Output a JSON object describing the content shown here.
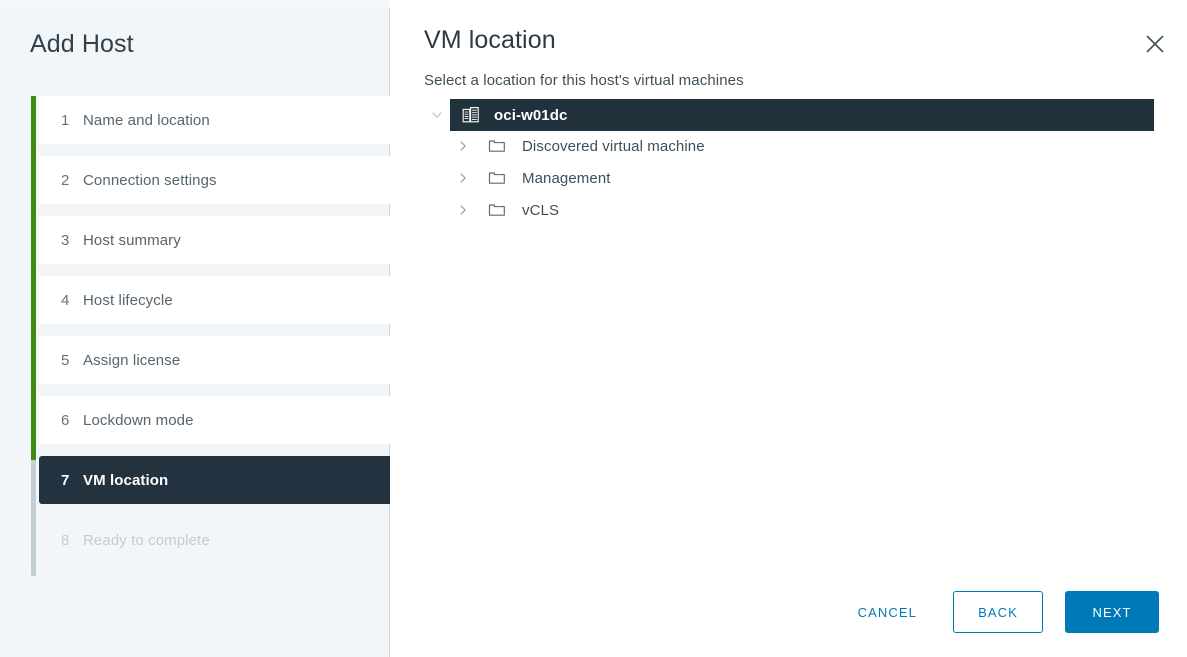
{
  "wizard": {
    "title": "Add Host",
    "steps": [
      {
        "num": "1",
        "label": "Name and location",
        "state": "done"
      },
      {
        "num": "2",
        "label": "Connection settings",
        "state": "done"
      },
      {
        "num": "3",
        "label": "Host summary",
        "state": "done"
      },
      {
        "num": "4",
        "label": "Host lifecycle",
        "state": "done"
      },
      {
        "num": "5",
        "label": "Assign license",
        "state": "done"
      },
      {
        "num": "6",
        "label": "Lockdown mode",
        "state": "done"
      },
      {
        "num": "7",
        "label": "VM location",
        "state": "active"
      },
      {
        "num": "8",
        "label": "Ready to complete",
        "state": "disabled"
      }
    ]
  },
  "main": {
    "title": "VM location",
    "subtitle": "Select a location for this host's virtual machines",
    "close_icon": "close-icon"
  },
  "tree": {
    "root": {
      "label": "oci-w01dc",
      "icon": "datacenter-icon",
      "twisty": "chevron-down-icon",
      "selected": true
    },
    "children": [
      {
        "label": "Discovered virtual machine",
        "icon": "folder-icon",
        "twisty": "chevron-right-icon"
      },
      {
        "label": "Management",
        "icon": "folder-icon",
        "twisty": "chevron-right-icon"
      },
      {
        "label": "vCLS",
        "icon": "folder-icon",
        "twisty": "chevron-right-icon"
      }
    ]
  },
  "footer": {
    "cancel_label": "CANCEL",
    "back_label": "BACK",
    "next_label": "NEXT"
  },
  "colors": {
    "accent_blue": "#0079b8",
    "progress_green": "#3f8a10",
    "active_dark": "#23323f",
    "selected_dark": "#22323c",
    "sidebar_bg": "#f2f6f8"
  }
}
